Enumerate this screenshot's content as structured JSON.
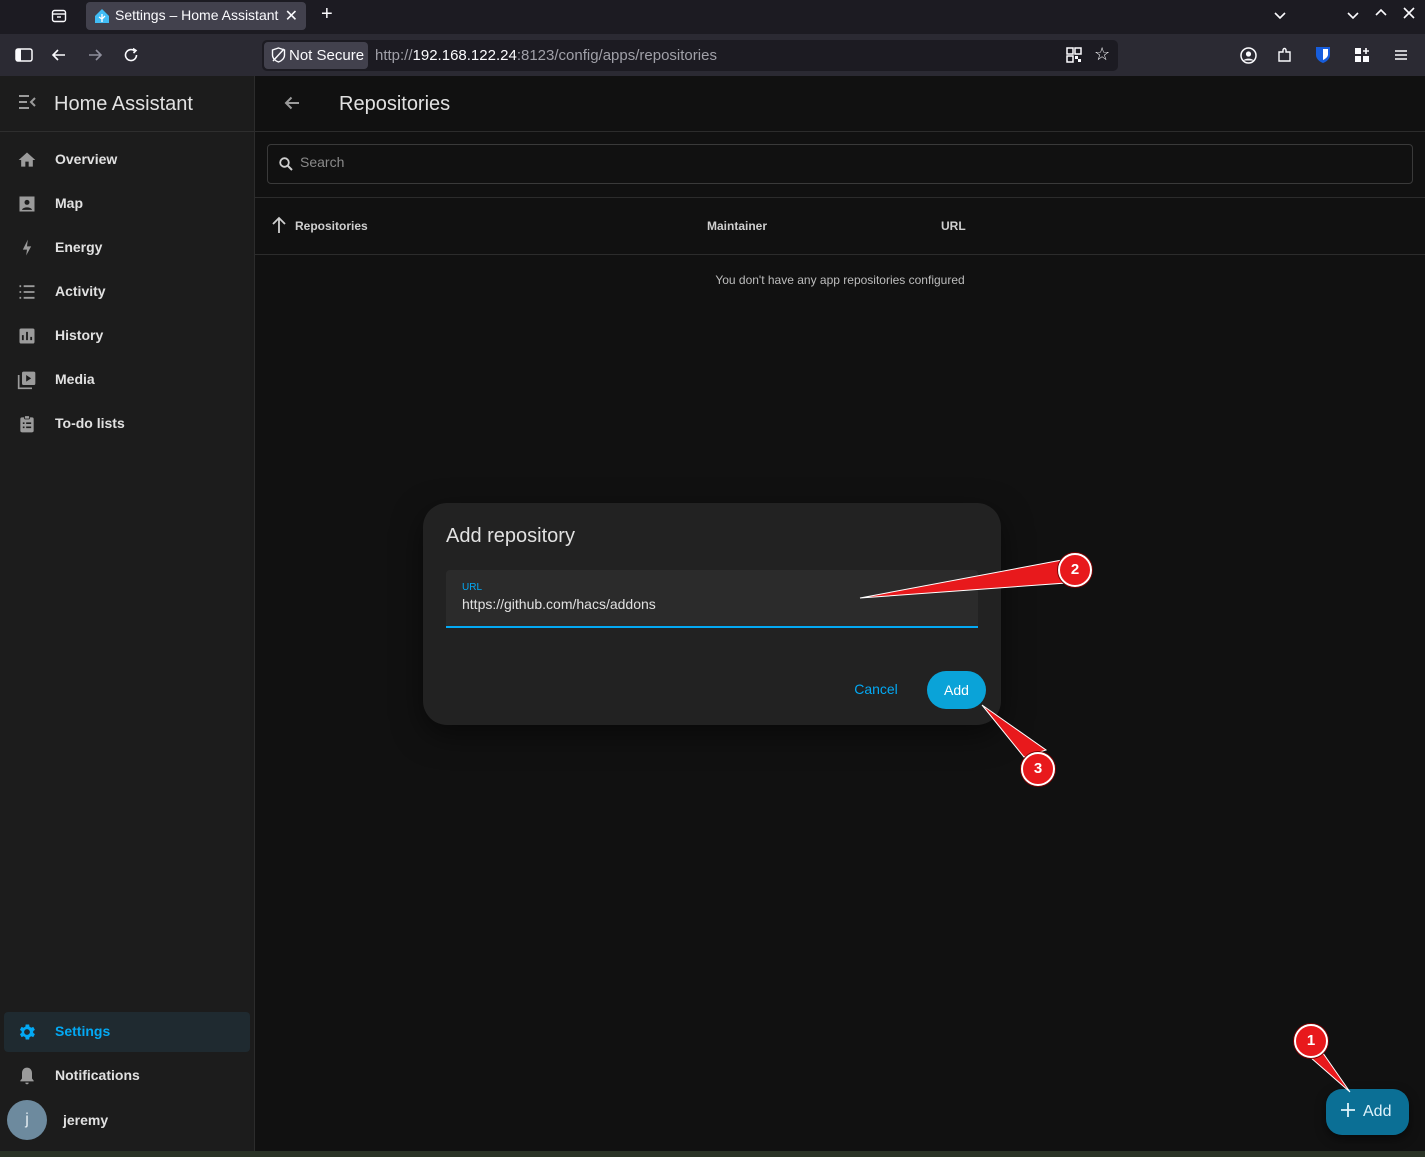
{
  "browser": {
    "tab_title": "Settings – Home Assistant",
    "security_label": "Not Secure",
    "url_prefix": "http://",
    "url_host": "192.168.122.24",
    "url_rest": ":8123/config/apps/repositories"
  },
  "sidebar": {
    "title": "Home Assistant",
    "items": [
      {
        "label": "Overview",
        "icon": "home-icon"
      },
      {
        "label": "Map",
        "icon": "map-icon"
      },
      {
        "label": "Energy",
        "icon": "lightning-icon"
      },
      {
        "label": "Activity",
        "icon": "list-icon"
      },
      {
        "label": "History",
        "icon": "chart-box-icon"
      },
      {
        "label": "Media",
        "icon": "play-box-icon"
      },
      {
        "label": "To-do lists",
        "icon": "clipboard-list-icon"
      }
    ],
    "bottom_items": [
      {
        "label": "Settings",
        "icon": "gear-icon",
        "selected": true
      },
      {
        "label": "Notifications",
        "icon": "bell-icon"
      }
    ],
    "user": {
      "initial": "j",
      "name": "jeremy"
    }
  },
  "header": {
    "title": "Repositories"
  },
  "search": {
    "placeholder": "Search"
  },
  "table": {
    "columns": [
      "Repositories",
      "Maintainer",
      "URL"
    ],
    "empty_message": "You don't have any app repositories configured"
  },
  "dialog": {
    "title": "Add repository",
    "field_label": "URL",
    "field_value": "https://github.com/hacs/addons",
    "cancel_label": "Cancel",
    "add_label": "Add"
  },
  "fab": {
    "label": "Add"
  },
  "annotations": [
    "1",
    "2",
    "3"
  ],
  "colors": {
    "accent": "#03a9f4",
    "annotation": "#e8191c",
    "fab": "#0b6f95"
  }
}
